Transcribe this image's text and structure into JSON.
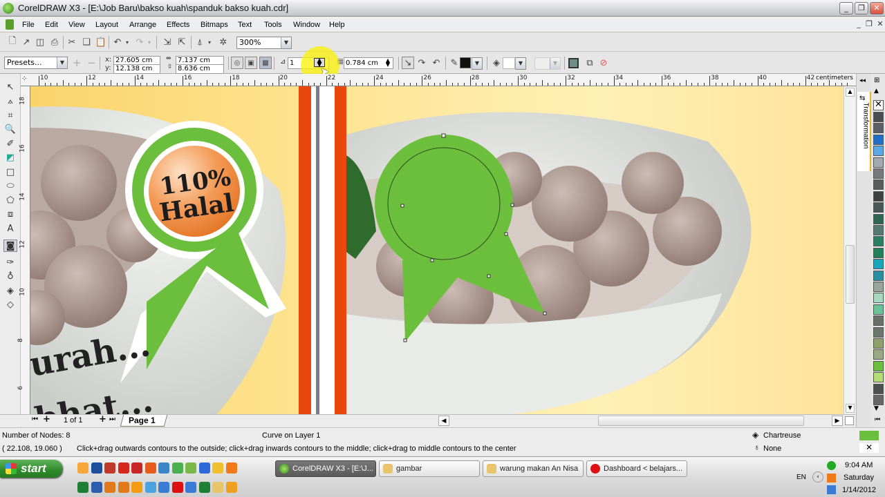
{
  "window": {
    "title": "CorelDRAW X3 - [E:\\Job Baru\\bakso kuah\\spanduk bakso kuah.cdr]",
    "controls": [
      "minimize",
      "restore",
      "close"
    ]
  },
  "menu": {
    "items": [
      "File",
      "Edit",
      "View",
      "Layout",
      "Arrange",
      "Effects",
      "Bitmaps",
      "Text",
      "Tools",
      "Window",
      "Help"
    ]
  },
  "standard_toolbar": {
    "zoom_level": "300%",
    "icons": [
      "new-icon",
      "open-icon",
      "save-icon",
      "print-icon",
      "cut-icon",
      "copy-icon",
      "paste-icon",
      "undo-icon",
      "redo-icon",
      "import-icon",
      "export-icon",
      "application-launcher-icon",
      "corel-online-icon"
    ]
  },
  "property_bar": {
    "presets": "Presets...",
    "x_label": "x:",
    "x_value": "27.605 cm",
    "y_label": "y:",
    "y_value": "12.138 cm",
    "width_value": "7.137 cm",
    "height_value": "8.636 cm",
    "steps_value": "1",
    "offset_value": "0.784 cm"
  },
  "ruler": {
    "units": "centimeters",
    "h_ticks": [
      "10",
      "12",
      "14",
      "16",
      "18",
      "20",
      "22",
      "24",
      "26",
      "28",
      "30",
      "32",
      "34",
      "36",
      "38",
      "40",
      "42"
    ],
    "v_ticks": [
      "18",
      "16",
      "14",
      "12",
      "10",
      "8",
      "6"
    ]
  },
  "canvas": {
    "badge_line1": "110%",
    "badge_line2": "Halal",
    "bowl_text_line1": "urah...",
    "bowl_text_line2": "bhat...",
    "colors": {
      "ribbon_green": "#6cbf3c",
      "badge_orange": "#ef8a3c",
      "stripe_orange": "#e8480c",
      "background_yellow": "#fde28c"
    }
  },
  "page_nav": {
    "counter": "1 of 1",
    "page_tab": "Page 1"
  },
  "docker": {
    "tab_label": "Transformation"
  },
  "palette": {
    "colors": [
      "#4b4b52",
      "#5c6066",
      "#1f6fc8",
      "#5aa9e6",
      "#a4abb0",
      "#77797c",
      "#5a5c5c",
      "#3f4140",
      "#465756",
      "#2e6656",
      "#527a70",
      "#2a7e61",
      "#23805b",
      "#1ba5b8",
      "#2a8fa0",
      "#98a49e",
      "#a8d8c2",
      "#6bc19a",
      "#6a7069",
      "#6d766c",
      "#8ea06c",
      "#9aa884",
      "#6cbf3c",
      "#b5dd76",
      "#4e5050",
      "#666666"
    ]
  },
  "status": {
    "nodes": "Number of Nodes: 8",
    "object": "Curve on Layer 1",
    "coords": "( 22.108, 19.060 )",
    "hint": "Click+drag outwards contours to the outside; click+drag inwards contours to the middle; click+drag to middle contours to the center",
    "fill_name": "Chartreuse",
    "outline_name": "None",
    "fill_color": "#6cbf3c"
  },
  "taskbar": {
    "start_label": "start",
    "tasks": [
      "CorelDRAW X3 - [E:\\J...",
      "gambar",
      "warung makan An Nisa",
      "Dashboard < belajars..."
    ],
    "language": "EN",
    "time": "9:04 AM",
    "day": "Saturday",
    "date": "1/14/2012"
  }
}
